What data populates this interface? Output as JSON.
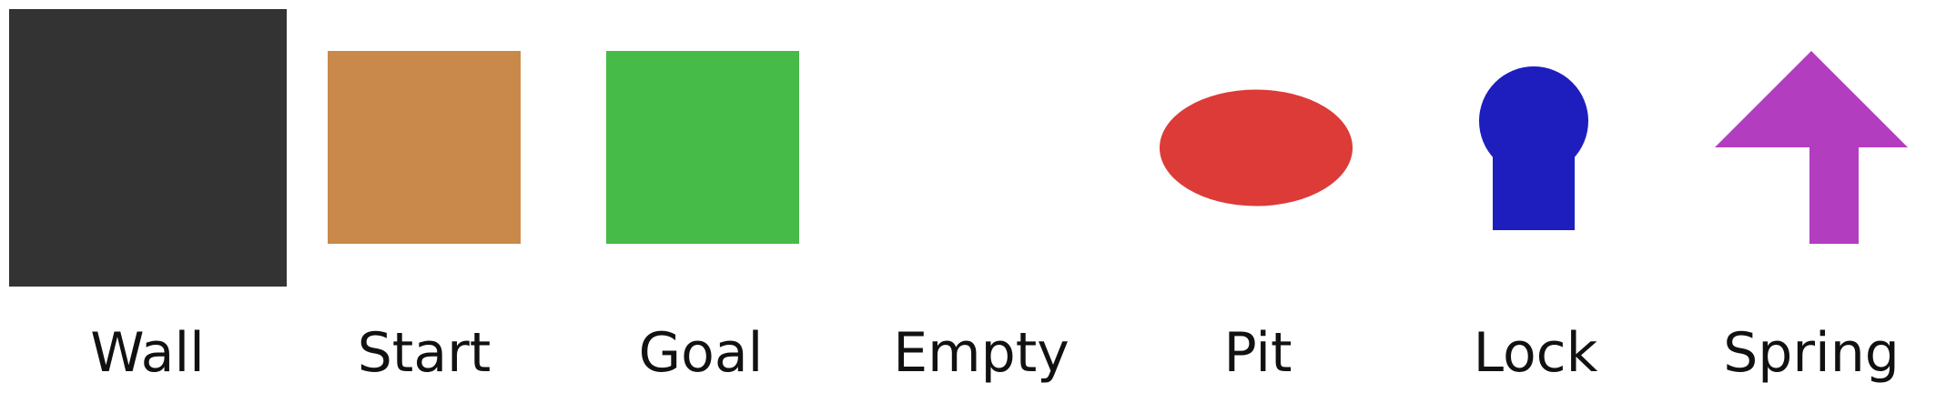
{
  "legend": {
    "tiles": [
      {
        "label": "Wall",
        "icon": "wall-square",
        "color": "#333333"
      },
      {
        "label": "Start",
        "icon": "start-square",
        "color": "#c8894a"
      },
      {
        "label": "Goal",
        "icon": "goal-square",
        "color": "#47bb47"
      },
      {
        "label": "Empty",
        "icon": "empty-blank",
        "color": "#ffffff"
      },
      {
        "label": "Pit",
        "icon": "pit-ellipse",
        "color": "#dc3b38"
      },
      {
        "label": "Lock",
        "icon": "keyhole-icon",
        "color": "#1e1ebf"
      },
      {
        "label": "Spring",
        "icon": "arrow-up-icon",
        "color": "#b33dbf"
      }
    ]
  }
}
